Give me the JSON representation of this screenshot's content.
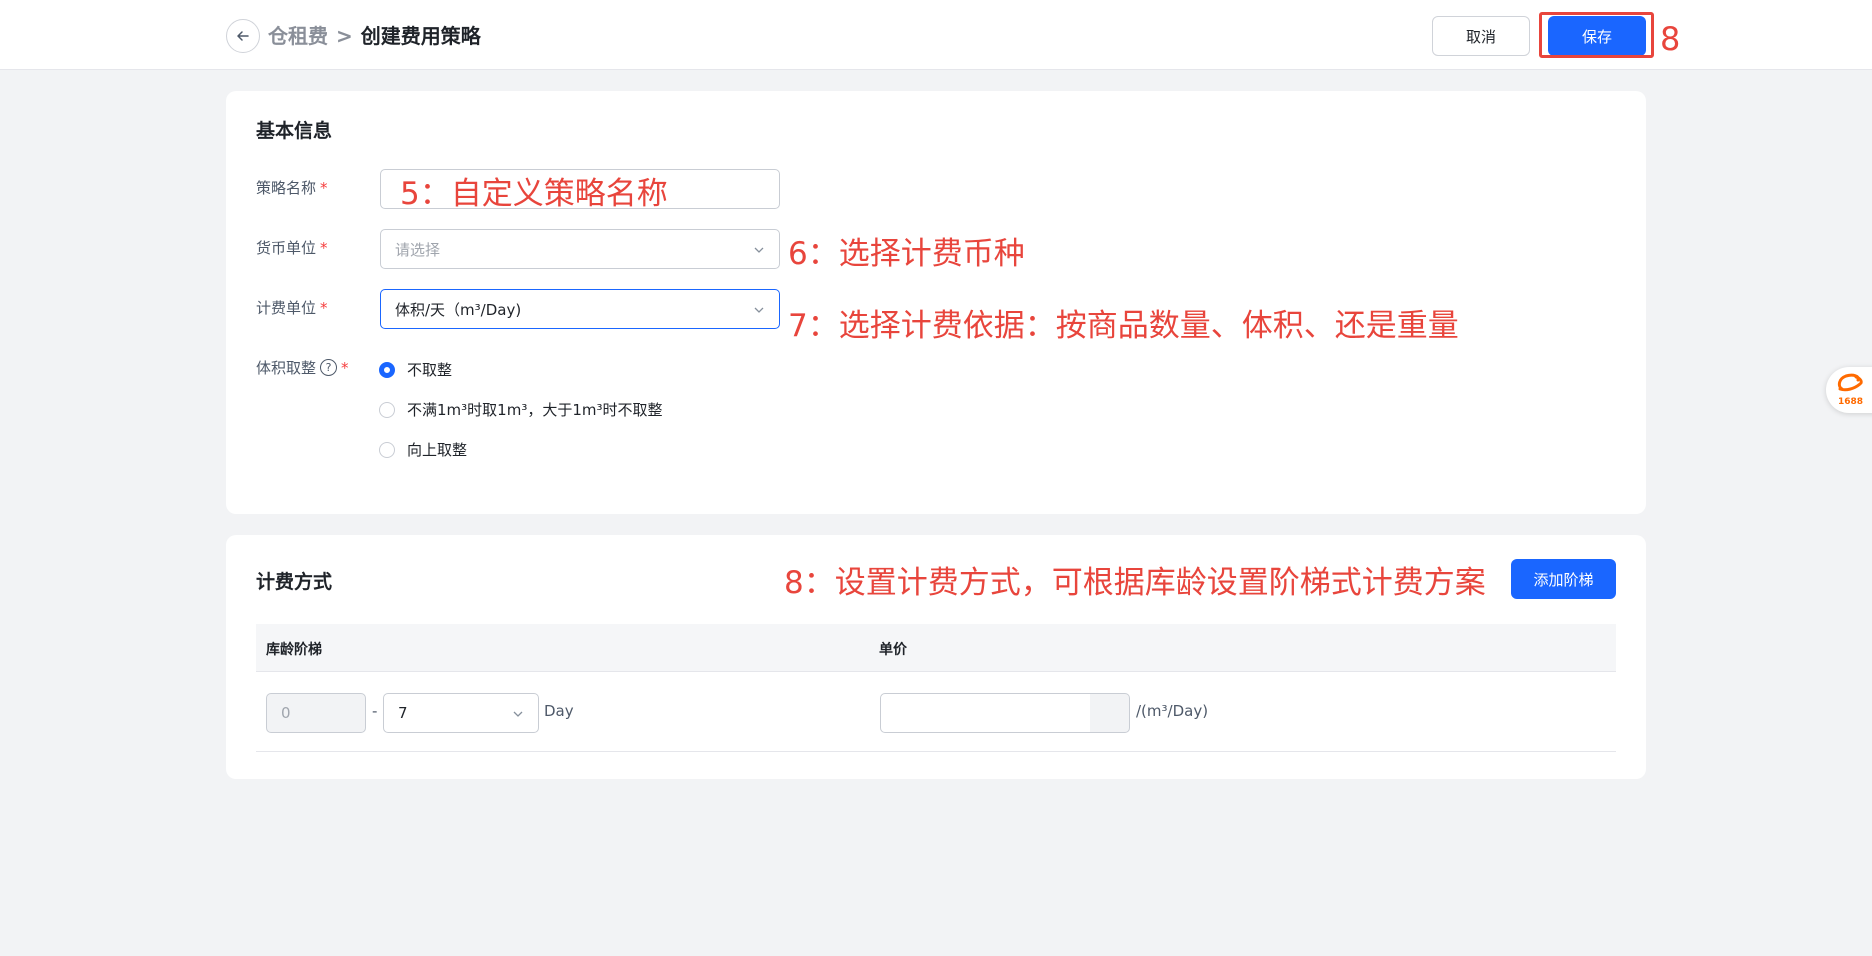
{
  "header": {
    "breadcrumb_parent": "仓租费",
    "breadcrumb_separator": ">",
    "breadcrumb_current": "创建费用策略",
    "cancel_label": "取消",
    "save_label": "保存",
    "save_annotation": "8"
  },
  "basic_info": {
    "title": "基本信息",
    "strategy_name": {
      "label": "策略名称",
      "required_mark": "*",
      "annotation": "5：自定义策略名称"
    },
    "currency": {
      "label": "货币单位",
      "required_mark": "*",
      "placeholder": "请选择",
      "annotation": "6：选择计费币种"
    },
    "billing_unit": {
      "label": "计费单位",
      "required_mark": "*",
      "value": "体积/天（m³/Day)",
      "annotation": "7：选择计费依据：按商品数量、体积、还是重量"
    },
    "volume_rounding": {
      "label": "体积取整",
      "required_mark": "*",
      "help_glyph": "?",
      "options": [
        {
          "label": "不取整",
          "selected": true
        },
        {
          "label": "不满1m³时取1m³，大于1m³时不取整",
          "selected": false
        },
        {
          "label": "向上取整",
          "selected": false
        }
      ]
    }
  },
  "billing_method": {
    "title": "计费方式",
    "annotation": "8：设置计费方式，可根据库龄设置阶梯式计费方案",
    "add_tier_label": "添加阶梯",
    "columns": [
      "库龄阶梯",
      "单价"
    ],
    "rows": [
      {
        "from": "0",
        "dash": "-",
        "to": "7",
        "day_unit": "Day",
        "price": "",
        "price_unit": "/(m³/Day)"
      }
    ]
  },
  "side_widget": {
    "logo_text": "1688"
  },
  "colors": {
    "primary": "#1a66ff",
    "annotation_red": "#e8453c",
    "required_red": "#f53f3f"
  }
}
